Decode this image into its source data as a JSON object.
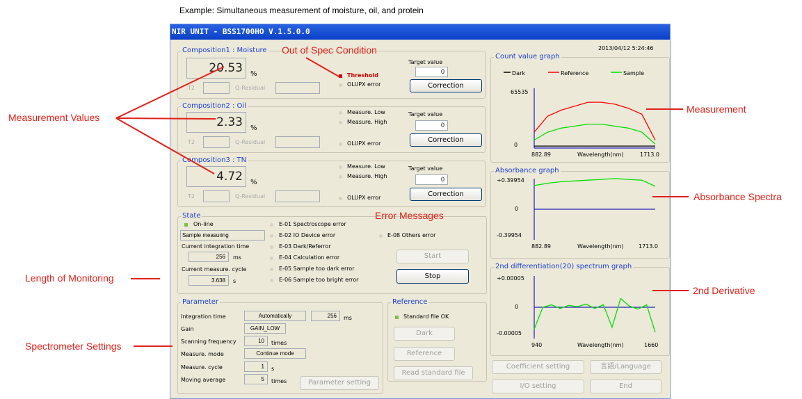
{
  "caption": "Example:  Simultaneous measurement of moisture, oil, and protein",
  "window": {
    "title": "NIR UNIT - BSS1700HO V.1.5.0.0",
    "timestamp": "2013/04/12 5:24:46"
  },
  "compositions": [
    {
      "title": "Composition1 : Moisture",
      "value": "20.53",
      "unit": "%",
      "t2_label": "T2",
      "q_label": "Q-Residual",
      "status1": "Threshold",
      "status2": "OLUPX error",
      "target_label": "Target value",
      "target_value": "0",
      "correction": "Correction"
    },
    {
      "title": "Composition2 : Oil",
      "value": "2.33",
      "unit": "%",
      "t2_label": "T2",
      "q_label": "Q-Residual",
      "low": "Measure. Low",
      "high": "Measure. High",
      "olupx": "OLUPX error",
      "target_label": "Target value",
      "target_value": "0",
      "correction": "Correction"
    },
    {
      "title": "Composition3 : TN",
      "value": "4.72",
      "unit": "%",
      "t2_label": "T2",
      "q_label": "Q-Residual",
      "low": "Measure. Low",
      "high": "Measure. High",
      "olupx": "OLUPX error",
      "target_label": "Target value",
      "target_value": "0",
      "correction": "Correction"
    }
  ],
  "state": {
    "title": "State",
    "online": "On-line",
    "mode": "Sample measuring",
    "integ_label": "Current integration time",
    "integ_value": "256",
    "integ_unit": "ms",
    "cycle_label": "Current measure. cycle",
    "cycle_value": "3.638",
    "cycle_unit": "s",
    "errors": [
      "E-01 Spectroscope error",
      "E-02 IO Device error",
      "E-03 Dark/Referror",
      "E-04 Calculation error",
      "E-05 Sample too dark error",
      "E-06 Sample too bright error"
    ],
    "other_error": "E-08 Others error",
    "start": "Start",
    "stop": "Stop"
  },
  "parameter": {
    "title": "Parameter",
    "integ_label": "Integration time",
    "integ_mode": "Automatically",
    "integ_value": "256",
    "integ_unit": "ms",
    "gain_label": "Gain",
    "gain_value": "GAIN_LOW",
    "scan_label": "Scanning frequency",
    "scan_value": "10",
    "scan_unit": "times",
    "mode_label": "Measure. mode",
    "mode_value": "Continue mode",
    "cycle_label": "Measure. cycle",
    "cycle_value": "1",
    "cycle_unit": "s",
    "avg_label": "Moving average",
    "avg_value": "5",
    "avg_unit": "times",
    "setting_button": "Parameter setting"
  },
  "reference": {
    "title": "Reference",
    "status": "Standard file OK",
    "dark": "Dark",
    "reference": "Reference",
    "read": "Read standard file"
  },
  "footer_buttons": {
    "coefficient": "Coefficient setting",
    "language": "言語/Language",
    "io": "I/O setting",
    "end": "End"
  },
  "annotations": {
    "out_of_spec": "Out of Spec Condition",
    "measurement_values": "Measurement Values",
    "error_messages": "Error Messages",
    "length_monitoring": "Length of Monitoring",
    "spectrometer_settings": "Spectrometer Settings",
    "measurement": "Measurement",
    "absorbance_spectra": "Absorbance Spectra",
    "second_derivative": "2nd Derivative"
  },
  "colors": {
    "annotation": "#e0221b",
    "title_bar": "#0a3fc6",
    "dark": "#000000",
    "reference": "#ff0000",
    "sample": "#00e000",
    "axis": "#2020c0"
  },
  "chart_data": [
    {
      "type": "line",
      "title": "Count value graph",
      "xlabel": "Wavelength(nm)",
      "ymax_label": "65535",
      "ymin_label": "0",
      "x_start": "882.89",
      "x_end": "1713.0",
      "series": [
        {
          "name": "Dark",
          "values": [
            1,
            1,
            1,
            1,
            1,
            1,
            1,
            1,
            1,
            1
          ]
        },
        {
          "name": "Reference",
          "values": [
            8,
            16,
            19,
            21,
            23,
            23,
            22,
            20,
            17,
            4
          ]
        },
        {
          "name": "Sample",
          "values": [
            4,
            8,
            10,
            11,
            12,
            12,
            11,
            10,
            8,
            2
          ]
        }
      ]
    },
    {
      "type": "line",
      "title": "Absorbance graph",
      "xlabel": "Wavelength(nm)",
      "ymax_label": "+0.39954",
      "zero_label": "0",
      "ymin_label": "-0.39954",
      "x_start": "882.89",
      "x_end": "1713.0",
      "series": [
        {
          "values": [
            0.31,
            0.34,
            0.36,
            0.37,
            0.38,
            0.39,
            0.4,
            0.39,
            0.38,
            0.3
          ]
        }
      ]
    },
    {
      "type": "line",
      "title": "2nd differentiation(20) spectrum graph",
      "xlabel": "Wavelength(nm)",
      "ymax_label": "+0.00005",
      "zero_label": "0",
      "ymin_label": "-0.00005",
      "x_start": "940",
      "x_end": "1660",
      "series": [
        {
          "values": [
            -3.5e-05,
            0.0,
            4e-06,
            -2e-06,
            3e-06,
            1e-06,
            5e-06,
            -2e-06,
            4e-06,
            -3.2e-05,
            1.4e-05,
            2e-06,
            -3e-06,
            4e-06,
            -4e-05
          ]
        }
      ]
    }
  ]
}
